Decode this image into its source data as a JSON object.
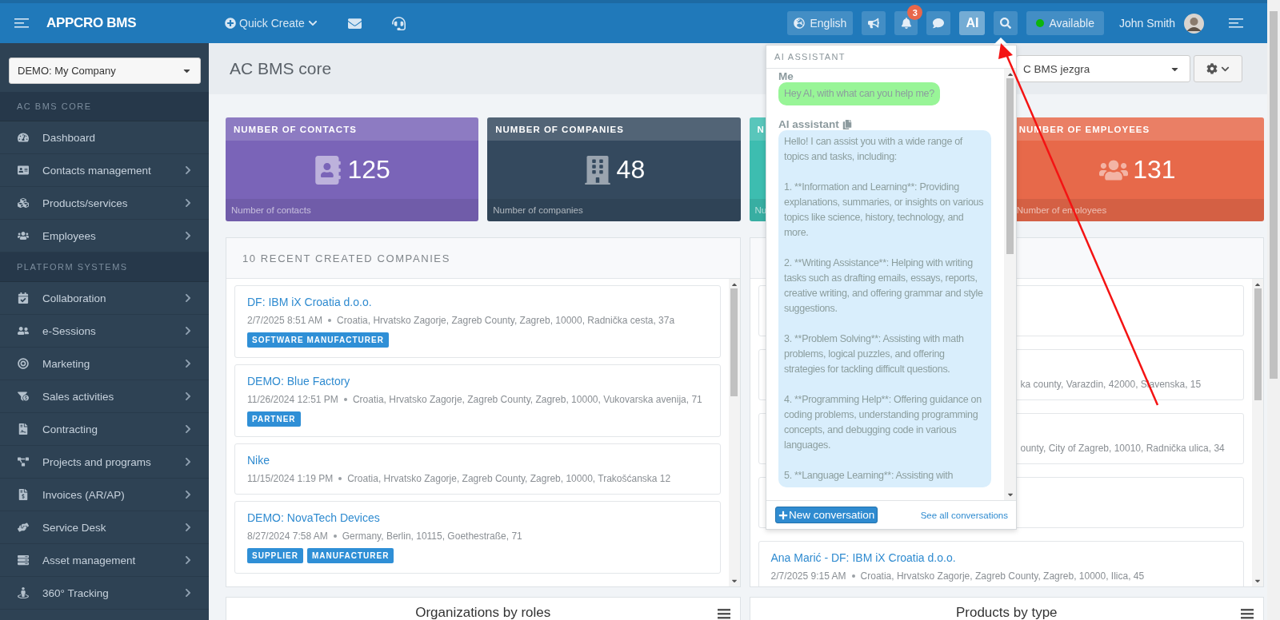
{
  "top_bar": {
    "brand": "APPCRO BMS",
    "quick_create": "Quick Create",
    "language": "English",
    "notifications": "3",
    "ai_button": {
      "label": "AI",
      "selected": true
    },
    "status": "Available",
    "user": "John Smith"
  },
  "sidebar": {
    "company_select": "DEMO: My Company",
    "sections": [
      {
        "title": "AC BMS CORE",
        "items": [
          {
            "label": "Dashboard",
            "has_submenu": false
          },
          {
            "label": "Contacts management",
            "has_submenu": true
          },
          {
            "label": "Products/services",
            "has_submenu": true
          },
          {
            "label": "Employees",
            "has_submenu": true
          }
        ]
      },
      {
        "title": "PLATFORM SYSTEMS",
        "items": [
          {
            "label": "Collaboration",
            "has_submenu": true
          },
          {
            "label": "e-Sessions",
            "has_submenu": true
          },
          {
            "label": "Marketing",
            "has_submenu": true
          },
          {
            "label": "Sales activities",
            "has_submenu": true
          },
          {
            "label": "Contracting",
            "has_submenu": true
          },
          {
            "label": "Projects and programs",
            "has_submenu": true
          },
          {
            "label": "Invoices (AR/AP)",
            "has_submenu": true
          },
          {
            "label": "Service Desk",
            "has_submenu": true
          },
          {
            "label": "Asset management",
            "has_submenu": true
          },
          {
            "label": "360° Tracking",
            "has_submenu": true
          }
        ]
      }
    ]
  },
  "page": {
    "title": "AC BMS core",
    "workspace_select": "C BMS jezgra"
  },
  "stat_cards": [
    {
      "title": "NUMBER OF CONTACTS",
      "value": "125",
      "footer": "Number of contacts",
      "color": "#7a64b8"
    },
    {
      "title": "NUMBER OF COMPANIES",
      "value": "48",
      "footer": "Number of companies",
      "color": "#34495e"
    },
    {
      "title": "N",
      "footer": "Nu",
      "color": "#3dbdb0"
    },
    {
      "title": "NUMBER OF EMPLOYEES",
      "value": "131",
      "footer": "Number of employees",
      "color": "#e7694a"
    }
  ],
  "recent_companies": {
    "title": "10 RECENT CREATED COMPANIES",
    "items": [
      {
        "name": "DF: IBM iX Croatia d.o.o.",
        "date": "2/7/2025 8:51 AM",
        "address": "Croatia, Hrvatsko Zagorje, Zagreb County, Zagreb, 10000, Radnička cesta, 37a",
        "tags": [
          "SOFTWARE MANUFACTURER"
        ]
      },
      {
        "name": "DEMO: Blue Factory",
        "date": "11/26/2024 12:51 PM",
        "address": "Croatia, Hrvatsko Zagorje, Zagreb County, Zagreb, 10000, Vukovarska avenija, 71",
        "tags": [
          "PARTNER"
        ]
      },
      {
        "name": "Nike",
        "date": "11/15/2024 1:19 PM",
        "address": "Croatia, Hrvatsko Zagorje, Zagreb County, Zagreb, 10000, Trakošćanska 12"
      },
      {
        "name": "DEMO: NovaTech Devices",
        "date": "8/27/2024 7:58 AM",
        "address": "Germany, Berlin, 10115, Goethestraße, 71",
        "tags": [
          "SUPPLIER",
          "MANUFACTURER"
        ]
      }
    ]
  },
  "recent_contacts": {
    "items": [
      {
        "kind": "covered"
      },
      {
        "kind": "partial",
        "address": "ka county, Varazdin, 42000, Slavenska, 15"
      },
      {
        "kind": "partial",
        "address": "ounty, City of Zagreb, 10010, Radnička ulica, 34"
      },
      {
        "kind": "covered"
      },
      {
        "kind": "full",
        "name": "Ana Marić - DF: IBM iX Croatia d.o.o.",
        "date": "2/7/2025 9:15 AM",
        "address": "Croatia, Hrvatsko Zagorje, Zagreb County, Zagreb, 10000, Ilica, 45"
      }
    ]
  },
  "charts": [
    {
      "title": "Organizations by roles"
    },
    {
      "title": "Products by type"
    }
  ],
  "ai_assistant": {
    "title": "AI ASSISTANT",
    "messages": [
      {
        "kind": "user",
        "author": "Me",
        "paragraphs": [
          "Hey AI, with what can you help me?"
        ]
      },
      {
        "kind": "assistant",
        "author": "AI assistant",
        "paragraphs": [
          "Hello! I can assist you with a wide range of topics and tasks, including:",
          "1. **Information and Learning**: Providing explanations, summaries, or insights on various topics like science, history, technology, and more.",
          "2. **Writing Assistance**: Helping with writing tasks such as drafting emails, essays, reports, creative writing, and offering grammar and style suggestions.",
          "3. **Problem Solving**: Assisting with math problems, logical puzzles, and offering strategies for tackling difficult questions.",
          "4. **Programming Help**: Offering guidance on coding problems, understanding programming concepts, and debugging code in various languages.",
          "5. **Language Learning**: Assisting with"
        ]
      }
    ],
    "new_button": "New conversation",
    "all_link": "See all conversations"
  }
}
